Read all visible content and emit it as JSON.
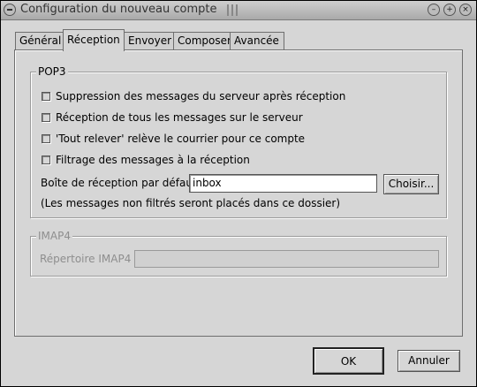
{
  "window": {
    "title": "Configuration du nouveau compte"
  },
  "tabs": [
    {
      "label": "Général"
    },
    {
      "label": "Réception"
    },
    {
      "label": "Envoyer"
    },
    {
      "label": "Composer"
    },
    {
      "label": "Avancée"
    }
  ],
  "pop3": {
    "legend": "POP3",
    "options": [
      {
        "label": "Suppression des messages du serveur après réception"
      },
      {
        "label": "Réception de tous les messages sur le serveur"
      },
      {
        "label": "'Tout relever' relève le courrier pour ce compte"
      },
      {
        "label": "Filtrage des messages à la réception"
      }
    ],
    "inbox_label": "Boîte de réception par défaut",
    "inbox_value": "inbox",
    "choose_button": "Choisir...",
    "note": "(Les messages non filtrés seront placés dans ce dossier)"
  },
  "imap4": {
    "legend": "IMAP4",
    "directory_label": "Répertoire IMAP4",
    "directory_value": ""
  },
  "buttons": {
    "ok": "OK",
    "cancel": "Annuler"
  }
}
